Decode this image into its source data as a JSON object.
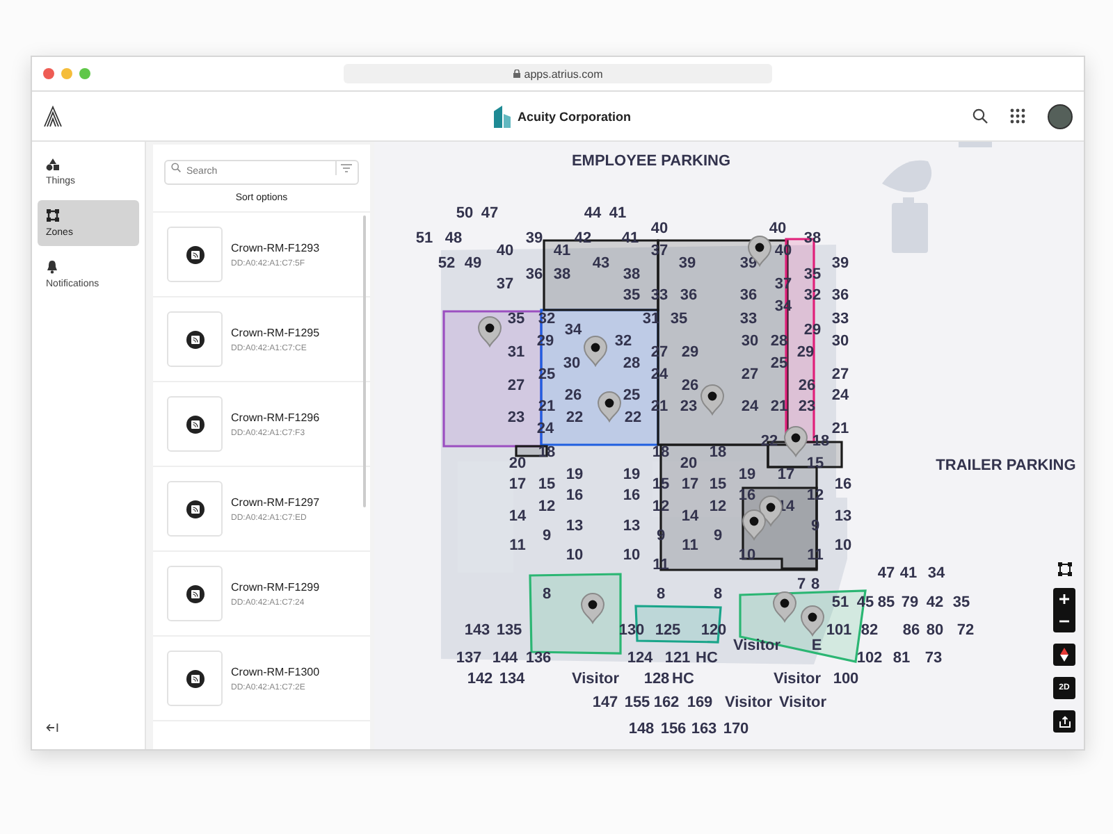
{
  "browser": {
    "url": "apps.atrius.com"
  },
  "header": {
    "title": "Acuity Corporation"
  },
  "nav": {
    "items": [
      {
        "kind": "things",
        "label": "Things",
        "selected": false
      },
      {
        "kind": "zones",
        "label": "Zones",
        "selected": true
      },
      {
        "kind": "notifications",
        "label": "Notifications",
        "selected": false
      }
    ]
  },
  "list": {
    "search": {
      "placeholder": "Search"
    },
    "sort_label": "Sort options",
    "items": [
      {
        "name": "Crown-RM-F1293",
        "address": "DD:A0:42:A1:C7:5F"
      },
      {
        "name": "Crown-RM-F1295",
        "address": "DD:A0:42:A1:C7:CE"
      },
      {
        "name": "Crown-RM-F1296",
        "address": "DD:A0:42:A1:C7:F3"
      },
      {
        "name": "Crown-RM-F1297",
        "address": "DD:A0:42:A1:C7:ED"
      },
      {
        "name": "Crown-RM-F1299",
        "address": "DD:A0:42:A1:C7:24"
      },
      {
        "name": "Crown-RM-F1300",
        "address": "DD:A0:42:A1:C7:2E"
      }
    ]
  },
  "map": {
    "areas": [
      "EMPLOYEE PARKING",
      "TRAILER PARKING"
    ],
    "zones": [
      {
        "color": "#9b4fc0"
      },
      {
        "color": "#1f5fe0"
      },
      {
        "color": "#1a1a1a"
      },
      {
        "color": "#1a1a1a"
      },
      {
        "color": "#e0207a"
      },
      {
        "color": "#1a1a1a"
      },
      {
        "color": "#1a1a1a"
      },
      {
        "color": "#1a1a1a"
      },
      {
        "color": "#1a1a1a"
      },
      {
        "color": "#2bb673"
      },
      {
        "color": "#1aa58a"
      },
      {
        "color": "#2bb673"
      }
    ],
    "labels": [
      "50",
      "47",
      "44",
      "41",
      "40",
      "40",
      "51",
      "48",
      "39",
      "42",
      "41",
      "38",
      "40",
      "41",
      "37",
      "40",
      "52",
      "49",
      "43",
      "39",
      "39",
      "39",
      "36",
      "38",
      "38",
      "35",
      "37",
      "37",
      "35",
      "33",
      "36",
      "36",
      "32",
      "36",
      "34",
      "35",
      "32",
      "31",
      "35",
      "33",
      "33",
      "34",
      "29",
      "29",
      "32",
      "30",
      "28",
      "30",
      "31",
      "27",
      "29",
      "29",
      "30",
      "28",
      "25",
      "25",
      "24",
      "27",
      "27",
      "27",
      "26",
      "26",
      "26",
      "25",
      "24",
      "21",
      "21",
      "23",
      "24",
      "21",
      "23",
      "23",
      "22",
      "22",
      "24",
      "21",
      "22",
      "18",
      "18",
      "18",
      "18",
      "20",
      "20",
      "15",
      "19",
      "19",
      "19",
      "17",
      "17",
      "15",
      "15",
      "17",
      "15",
      "16",
      "16",
      "16",
      "16",
      "12",
      "12",
      "12",
      "12",
      "14",
      "14",
      "14",
      "13",
      "13",
      "13",
      "9",
      "9",
      "9",
      "9",
      "11",
      "11",
      "10",
      "10",
      "10",
      "10",
      "11",
      "11",
      "47",
      "41",
      "34",
      "7",
      "8",
      "8",
      "8",
      "8",
      "51",
      "45",
      "85",
      "79",
      "42",
      "35",
      "143",
      "135",
      "130",
      "125",
      "120",
      "101",
      "82",
      "86",
      "80",
      "72",
      "Visitor",
      "E",
      "137",
      "144",
      "136",
      "124",
      "121",
      "HC",
      "102",
      "81",
      "73",
      "142",
      "134",
      "Visitor",
      "128",
      "HC",
      "Visitor",
      "100",
      "147",
      "155",
      "162",
      "169",
      "Visitor",
      "Visitor",
      "148",
      "156",
      "163",
      "170"
    ],
    "view_mode": "2D"
  }
}
